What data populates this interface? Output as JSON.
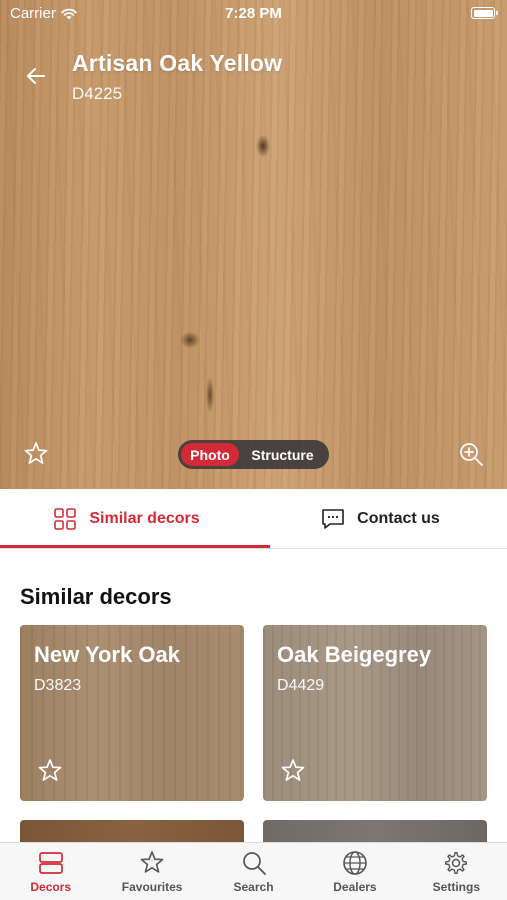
{
  "status_bar": {
    "carrier": "Carrier",
    "time": "7:28 PM"
  },
  "decor": {
    "title": "Artisan Oak Yellow",
    "code": "D4225"
  },
  "view_toggle": {
    "options": [
      "Photo",
      "Structure"
    ],
    "selected": "Photo"
  },
  "tabs": [
    {
      "label": "Similar decors",
      "icon": "grid-icon",
      "active": true
    },
    {
      "label": "Contact us",
      "icon": "chat-icon",
      "active": false
    }
  ],
  "section": {
    "title": "Similar decors"
  },
  "similar_decors": [
    {
      "name": "New York Oak",
      "code": "D3823"
    },
    {
      "name": "Oak Beigegrey",
      "code": "D4429"
    }
  ],
  "bottom_nav": [
    {
      "label": "Decors",
      "icon": "decors-icon",
      "active": true
    },
    {
      "label": "Favourites",
      "icon": "star-icon",
      "active": false
    },
    {
      "label": "Search",
      "icon": "search-icon",
      "active": false
    },
    {
      "label": "Dealers",
      "icon": "globe-icon",
      "active": false
    },
    {
      "label": "Settings",
      "icon": "gear-icon",
      "active": false
    }
  ],
  "colors": {
    "accent": "#d42a37",
    "toggle_bg": "#323237",
    "nav_bg": "#f7f7f7"
  }
}
